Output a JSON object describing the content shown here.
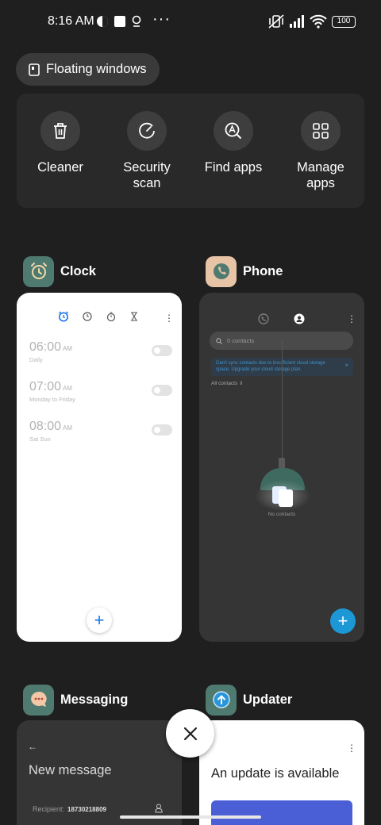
{
  "status_bar": {
    "time": "8:16 AM",
    "battery": "100",
    "more": "···"
  },
  "floating_windows": {
    "label": "Floating windows"
  },
  "tools": [
    {
      "label": "Cleaner",
      "icon": "trash-icon"
    },
    {
      "label": "Security scan",
      "icon": "security-scan-icon"
    },
    {
      "label": "Find apps",
      "icon": "find-apps-icon"
    },
    {
      "label": "Manage apps",
      "icon": "grid-icon"
    }
  ],
  "clock": {
    "app_name": "Clock",
    "icon_color": "#4f7a70",
    "alarms": [
      {
        "time": "06:00",
        "ampm": "AM",
        "repeat": "Daily"
      },
      {
        "time": "07:00",
        "ampm": "AM",
        "repeat": "Monday to Friday"
      },
      {
        "time": "08:00",
        "ampm": "AM",
        "repeat": "Sat Sun"
      }
    ],
    "fab": "+"
  },
  "phone": {
    "app_name": "Phone",
    "icon_color": "#e8c4a6",
    "search_placeholder": "0 contacts",
    "banner": "Can't sync contacts due to insufficient cloud storage space. Upgrade your cloud storage plan.",
    "banner_close": "×",
    "filter": "All contacts",
    "empty_label": "No contacts",
    "fab": "+"
  },
  "messaging": {
    "app_name": "Messaging",
    "icon_color": "#4f7a70",
    "back": "←",
    "title": "New message",
    "recipient_label": "Recipient:",
    "recipient_value": "18730218809"
  },
  "updater": {
    "app_name": "Updater",
    "icon_color": "#4f7a70",
    "title": "An update is available",
    "more": "⋮"
  },
  "colors": {
    "accent_blue": "#1a73e8",
    "fab_blue": "#1d98d6",
    "background": "#1f1f1f"
  }
}
